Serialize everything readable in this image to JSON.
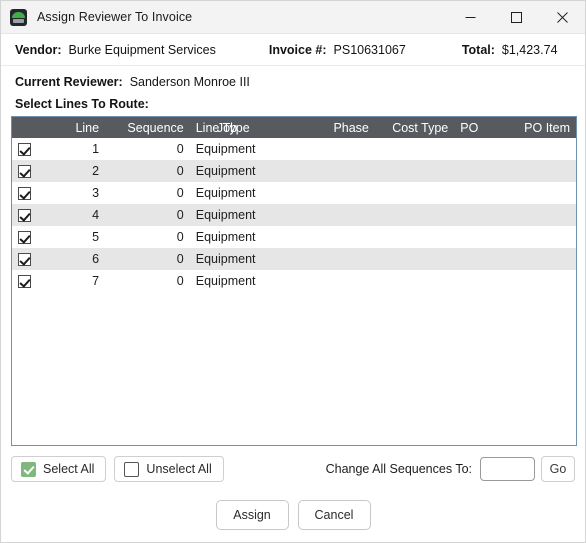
{
  "window": {
    "title": "Assign Reviewer To Invoice",
    "icon": "app-logo-icon",
    "controls": {
      "minimize": "Minimize",
      "maximize": "Maximize",
      "close": "Close"
    }
  },
  "header": {
    "vendor_label": "Vendor:",
    "vendor_value": "Burke Equipment Services",
    "invoice_label": "Invoice #:",
    "invoice_value": "PS10631067",
    "total_label": "Total:",
    "total_value": "$1,423.74"
  },
  "reviewer": {
    "label": "Current Reviewer:",
    "value": "Sanderson Monroe III"
  },
  "section": {
    "select_lines_label": "Select Lines To Route:"
  },
  "table": {
    "columns": [
      "Line",
      "Sequence",
      "Line Type",
      "Job",
      "Phase",
      "Cost Type",
      "PO",
      "PO Item"
    ],
    "rows": [
      {
        "checked": true,
        "line": "1",
        "sequence": "0",
        "line_type": "Equipment",
        "job": "",
        "phase": "",
        "cost_type": "",
        "po": "",
        "po_item": ""
      },
      {
        "checked": true,
        "line": "2",
        "sequence": "0",
        "line_type": "Equipment",
        "job": "",
        "phase": "",
        "cost_type": "",
        "po": "",
        "po_item": ""
      },
      {
        "checked": true,
        "line": "3",
        "sequence": "0",
        "line_type": "Equipment",
        "job": "",
        "phase": "",
        "cost_type": "",
        "po": "",
        "po_item": ""
      },
      {
        "checked": true,
        "line": "4",
        "sequence": "0",
        "line_type": "Equipment",
        "job": "",
        "phase": "",
        "cost_type": "",
        "po": "",
        "po_item": ""
      },
      {
        "checked": true,
        "line": "5",
        "sequence": "0",
        "line_type": "Equipment",
        "job": "",
        "phase": "",
        "cost_type": "",
        "po": "",
        "po_item": ""
      },
      {
        "checked": true,
        "line": "6",
        "sequence": "0",
        "line_type": "Equipment",
        "job": "",
        "phase": "",
        "cost_type": "",
        "po": "",
        "po_item": ""
      },
      {
        "checked": true,
        "line": "7",
        "sequence": "0",
        "line_type": "Equipment",
        "job": "",
        "phase": "",
        "cost_type": "",
        "po": "",
        "po_item": ""
      }
    ]
  },
  "toolbar": {
    "select_all_label": "Select All",
    "unselect_all_label": "Unselect All",
    "change_sequences_label": "Change All Sequences To:",
    "sequence_input_value": "",
    "sequence_input_placeholder": "",
    "go_label": "Go"
  },
  "actions": {
    "assign_label": "Assign",
    "cancel_label": "Cancel"
  },
  "colors": {
    "accent_green": "#7fb77e",
    "header_bar": "#575b5f",
    "grid_border": "#6e93b0",
    "alt_row": "#e6e6e6",
    "titlebar": "#f3f3f3"
  }
}
